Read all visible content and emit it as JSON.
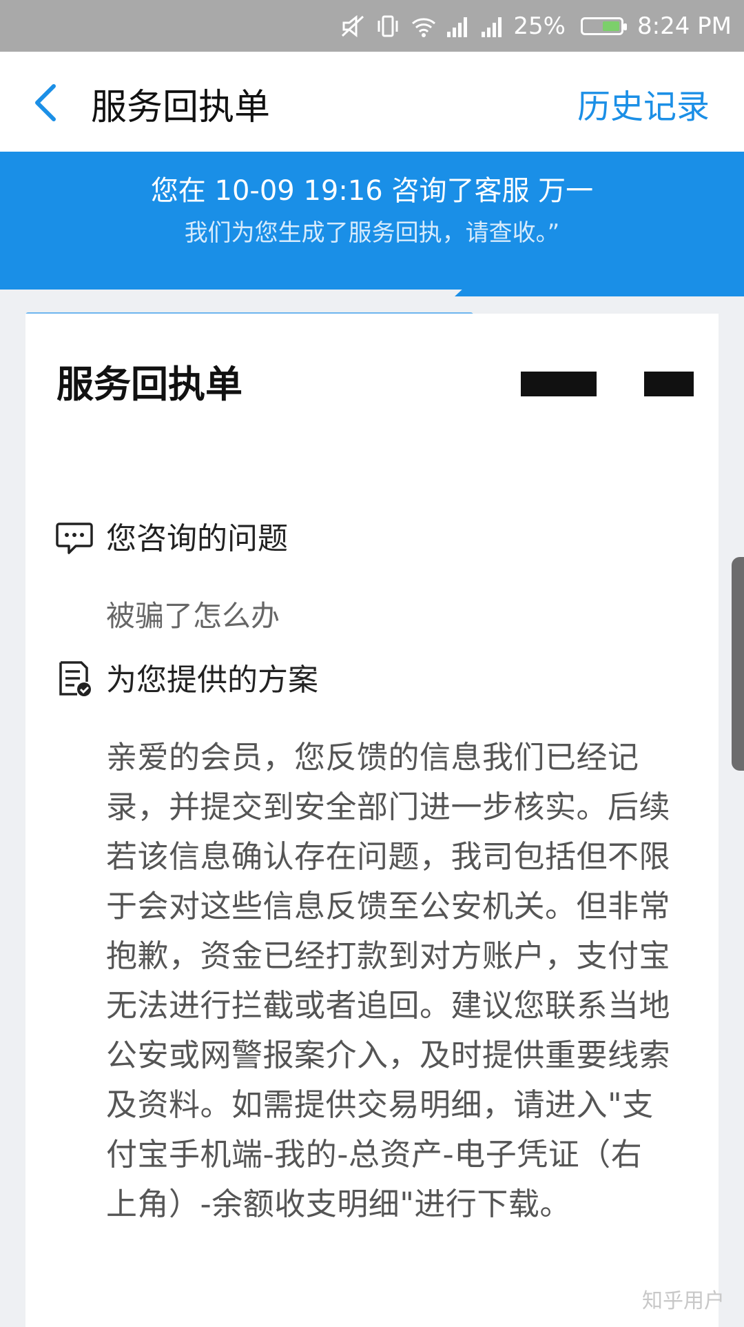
{
  "status_bar": {
    "battery": "25%",
    "time": "8:24 PM",
    "icons": [
      "mute-icon",
      "vibrate-icon",
      "wifi-icon",
      "signal-icon",
      "signal-icon",
      "battery-icon"
    ]
  },
  "header": {
    "title": "服务回执单",
    "history_label": "历史记录"
  },
  "banner": {
    "line1": "您在 10-09 19:16 咨询了客服 万一",
    "line2": "我们为您生成了服务回执，请查收。”"
  },
  "card": {
    "title": "服务回执单",
    "question_heading": "您咨询的问题",
    "question": "被骗了怎么办",
    "solution_heading": "为您提供的方案",
    "solution": "亲爱的会员，您反馈的信息我们已经记录，并提交到安全部门进一步核实。后续若该信息确认存在问题，我司包括但不限于会对这些信息反馈至公安机关。但非常抱歉，资金已经打款到对方账户，支付宝无法进行拦截或者追回。建议您联系当地公安或网警报案介入，及时提供重要线索及资料。如需提供交易明细，请进入\"支付宝手机端-我的-总资产-电子凭证（右上角）-余额收支明细\"进行下载。"
  },
  "watermark": "知乎用户",
  "colors": {
    "accent": "#1a8fe7",
    "status_bar": "#a9a9a9",
    "background": "#eef0f3"
  }
}
